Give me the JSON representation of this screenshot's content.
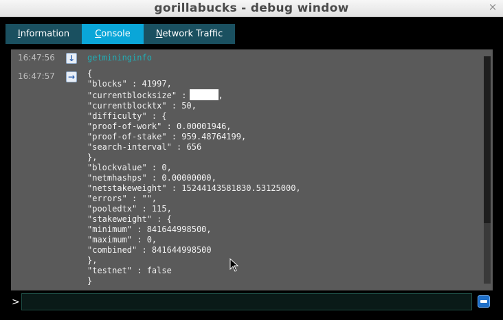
{
  "window": {
    "title": "gorillabucks - debug window",
    "close_glyph": "×"
  },
  "tabs": [
    {
      "prefix": "",
      "mnemonic": "I",
      "rest": "nformation",
      "active": false
    },
    {
      "prefix": "",
      "mnemonic": "C",
      "rest": "onsole",
      "active": true
    },
    {
      "prefix": "",
      "mnemonic": "N",
      "rest": "etwork Traffic",
      "active": false
    }
  ],
  "console": {
    "entries": [
      {
        "time": "16:47:56",
        "icon": "command-down-arrow-icon",
        "text": "getmininginfo"
      },
      {
        "time": "16:47:57",
        "icon": "reply-right-arrow-icon"
      }
    ],
    "output_before": "{\n\"blocks\" : 41997,\n\"currentblocksize\" :",
    "output_after": ",\n\"currentblocktx\" : 50,\n\"difficulty\" : {\n\"proof-of-work\" : 0.00001946,\n\"proof-of-stake\" : 959.48764199,\n\"search-interval\" : 656\n},\n\"blockvalue\" : 0,\n\"netmhashps\" : 0.00000000,\n\"netstakeweight\" : 15244143581830.53125000,\n\"errors\" : \"\",\n\"pooledtx\" : 115,\n\"stakeweight\" : {\n\"minimum\" : 841644998500,\n\"maximum\" : 0,\n\"combined\" : 841644998500\n},\n\"testnet\" : false\n}"
  },
  "input": {
    "prompt": ">",
    "value": ""
  },
  "colors": {
    "active_tab": "#0aa6d8",
    "inactive_tab": "#1a5060",
    "command_text": "#1fb0b8",
    "console_bg": "#5a5a5a"
  }
}
